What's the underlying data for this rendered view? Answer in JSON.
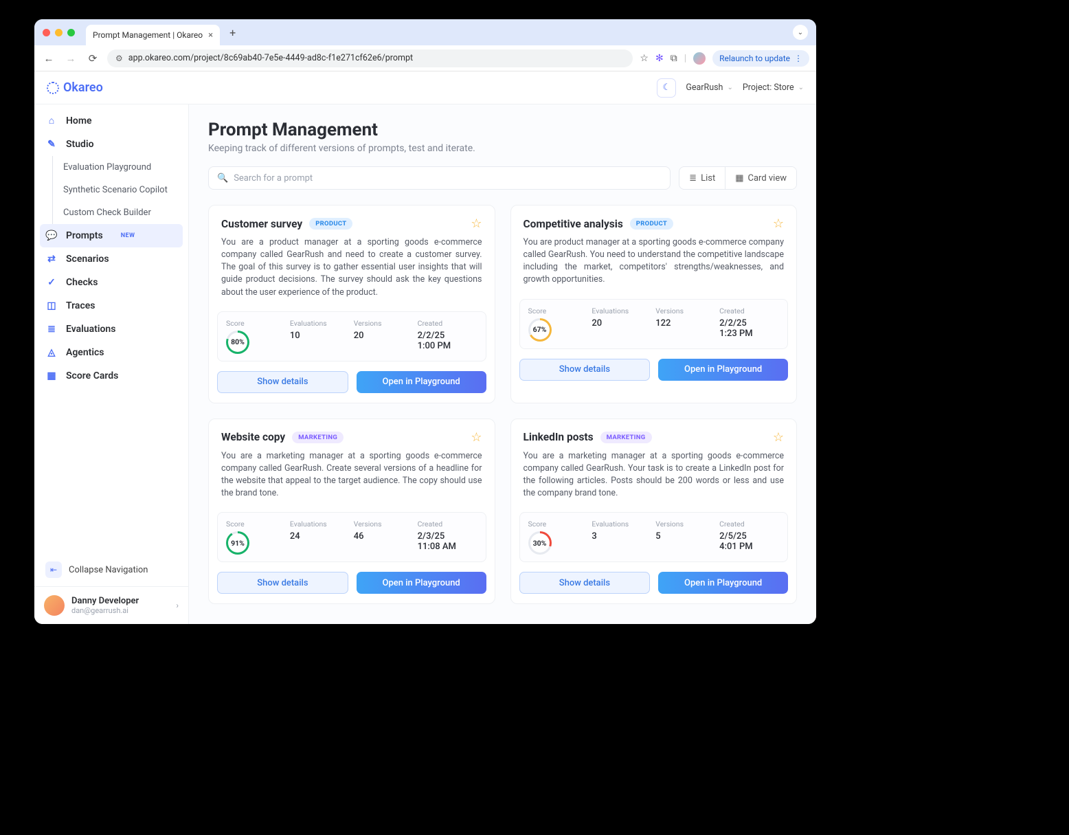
{
  "chrome": {
    "tab_title": "Prompt Management | Okareo",
    "url": "app.okareo.com/project/8c69ab40-7e5e-4449-ad8c-f1e271cf62e6/prompt",
    "relaunch": "Relaunch to update"
  },
  "topbar": {
    "brand": "Okareo",
    "org": "GearRush",
    "project": "Project: Store"
  },
  "sidebar": {
    "items": [
      {
        "label": "Home"
      },
      {
        "label": "Studio"
      },
      {
        "label": "Evaluation Playground"
      },
      {
        "label": "Synthetic Scenario Copilot"
      },
      {
        "label": "Custom Check Builder"
      },
      {
        "label": "Prompts",
        "badge": "NEW"
      },
      {
        "label": "Scenarios"
      },
      {
        "label": "Checks"
      },
      {
        "label": "Traces"
      },
      {
        "label": "Evaluations"
      },
      {
        "label": "Agentics"
      },
      {
        "label": "Score Cards"
      }
    ],
    "collapse": "Collapse Navigation",
    "user": {
      "name": "Danny Developer",
      "email": "dan@gearrush.ai"
    }
  },
  "page": {
    "title": "Prompt Management",
    "subtitle": "Keeping track of different versions of prompts, test and iterate.",
    "search_placeholder": "Search for a prompt",
    "view_list": "List",
    "view_card": "Card view",
    "stat_labels": {
      "score": "Score",
      "eval": "Evaluations",
      "ver": "Versions",
      "created": "Created"
    },
    "btn_details": "Show details",
    "btn_open": "Open in Playground"
  },
  "prompts": [
    {
      "title": "Customer survey",
      "tag": "PRODUCT",
      "tag_class": "product",
      "desc": "You are a product manager at a sporting goods e-commerce company called GearRush and need to create a customer survey. The  goal of this survey is to gather essential user insights that will guide product decisions. The survey should ask the key questions about the user experience of the product.",
      "score": "80%",
      "score_color": "#17b26a",
      "score_deg": 288,
      "eval": "10",
      "ver": "20",
      "created1": "2/2/25",
      "created2": "1:00 PM"
    },
    {
      "title": "Competitive analysis",
      "tag": "PRODUCT",
      "tag_class": "product",
      "desc": "You are product manager at a sporting goods e-commerce company called GearRush. You need to understand the competitive landscape including the market, competitors' strengths/weaknesses, and growth opportunities.",
      "score": "67%",
      "score_color": "#f6b73c",
      "score_deg": 241,
      "eval": "20",
      "ver": "122",
      "created1": "2/2/25",
      "created2": "1:23 PM"
    },
    {
      "title": "Website copy",
      "tag": "MARKETING",
      "tag_class": "marketing",
      "desc": "You are a marketing manager at a sporting goods e-commerce company called GearRush. Create several versions of a headline for the website that appeal to the target audience. The copy should use the brand tone.",
      "score": "91%",
      "score_color": "#17b26a",
      "score_deg": 328,
      "eval": "24",
      "ver": "46",
      "created1": "2/3/25",
      "created2": "11:08 AM"
    },
    {
      "title": "LinkedIn posts",
      "tag": "MARKETING",
      "tag_class": "marketing",
      "desc": "You are a marketing manager at a sporting goods e-commerce company called GearRush. Your task is to create a LinkedIn post for the following articles. Posts should be 200 words or less and use the company brand tone.",
      "score": "30%",
      "score_color": "#ef4a3c",
      "score_deg": 108,
      "eval": "3",
      "ver": "5",
      "created1": "2/5/25",
      "created2": "4:01 PM"
    }
  ]
}
